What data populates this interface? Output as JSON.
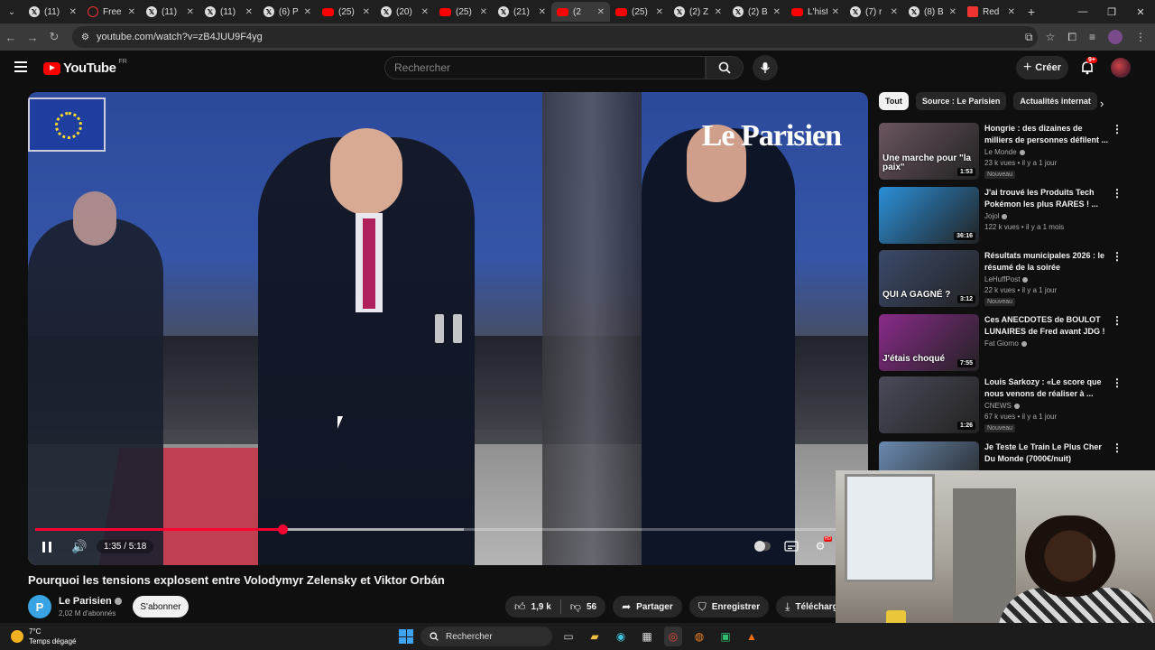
{
  "browser": {
    "tabs": [
      {
        "label": "(11)",
        "icon": "x-icon"
      },
      {
        "label": "Free",
        "icon": "free-icon"
      },
      {
        "label": "(11)",
        "icon": "x-icon"
      },
      {
        "label": "(11)",
        "icon": "x-icon"
      },
      {
        "label": "(6) P",
        "icon": "x-icon"
      },
      {
        "label": "(25)",
        "icon": "youtube-icon"
      },
      {
        "label": "(20)",
        "icon": "x-icon"
      },
      {
        "label": "(25)",
        "icon": "youtube-icon"
      },
      {
        "label": "(21)",
        "icon": "x-icon"
      },
      {
        "label": "(2",
        "icon": "youtube-icon",
        "active": true
      },
      {
        "label": "(25)",
        "icon": "youtube-icon"
      },
      {
        "label": "(2) Z",
        "icon": "x-icon"
      },
      {
        "label": "(2) B",
        "icon": "x-icon"
      },
      {
        "label": "L'hist",
        "icon": "youtube-icon"
      },
      {
        "label": "(7) r",
        "icon": "x-icon"
      },
      {
        "label": "(8) B",
        "icon": "x-icon"
      },
      {
        "label": "Red",
        "icon": "red-icon"
      }
    ],
    "url": "youtube.com/watch?v=zB4JUU9F4yg"
  },
  "youtube": {
    "logo_text": "YouTube",
    "country": "FR",
    "search_placeholder": "Rechercher",
    "create_label": "Créer",
    "notif_count": "9+"
  },
  "player": {
    "watermark": "Le Parisien",
    "time": "1:35 / 5:18",
    "progress": 0.3,
    "buffered": 0.52
  },
  "video": {
    "title": "Pourquoi les tensions explosent entre Volodymyr Zelensky et Viktor Orbán",
    "channel": "Le Parisien",
    "channel_initial": "P",
    "subscribers": "2,02 M d'abonnés",
    "subscribe_label": "S'abonner",
    "likes": "1,9 k",
    "dislikes": "56",
    "share_label": "Partager",
    "save_label": "Enregistrer",
    "download_label": "Télécharger"
  },
  "chips": [
    {
      "label": "Tout",
      "active": true
    },
    {
      "label": "Source : Le Parisien"
    },
    {
      "label": "Actualités internat"
    }
  ],
  "recommendations": [
    {
      "title": "Hongrie : des dizaines de milliers de personnes défilent ...",
      "channel": "Le Monde",
      "meta": "23 k vues • il y a 1 jour",
      "badge": "Nouveau",
      "duration": "1:53",
      "thumb_text": "Une marche pour \"la paix\"",
      "thumb_color": "#6a5560"
    },
    {
      "title": "J'ai trouvé les Produits Tech Pokémon les plus RARES ! ...",
      "channel": "Jojol",
      "meta": "122 k vues • il y a 1 mois",
      "badge": "",
      "duration": "36:16",
      "thumb_text": "",
      "thumb_color": "#2a8fd8"
    },
    {
      "title": "Résultats municipales 2026 : le résumé de la soirée",
      "channel": "LeHuffPost",
      "meta": "22 k vues • il y a 1 jour",
      "badge": "Nouveau",
      "duration": "3:12",
      "thumb_text": "QUI A GAGNÉ ?",
      "thumb_color": "#3b4a6a"
    },
    {
      "title": "Ces ANECDOTES de BOULOT LUNAIRES de Fred avant JDG !",
      "channel": "Fat Giorno",
      "meta": "",
      "badge": "",
      "duration": "7:55",
      "thumb_text": "J'étais choqué",
      "thumb_color": "#8a2a8a"
    },
    {
      "title": "Louis Sarkozy : «Le score que nous venons de réaliser à ...",
      "channel": "CNEWS",
      "meta": "67 k vues • il y a 1 jour",
      "badge": "Nouveau",
      "duration": "1:26",
      "thumb_text": "",
      "thumb_color": "#4a4a5a"
    },
    {
      "title": "Je Teste Le Train Le Plus Cher Du Monde (7000€/nuit)",
      "channel": "",
      "meta": "",
      "badge": "",
      "duration": "",
      "thumb_text": "",
      "thumb_color": "#6a8ab0"
    }
  ],
  "taskbar": {
    "temperature": "7°C",
    "weather": "Temps dégagé",
    "search_label": "Rechercher"
  },
  "colors": {
    "accent": "#ff0033",
    "youtube_red": "#ff0000",
    "background": "#0f0f0f"
  }
}
